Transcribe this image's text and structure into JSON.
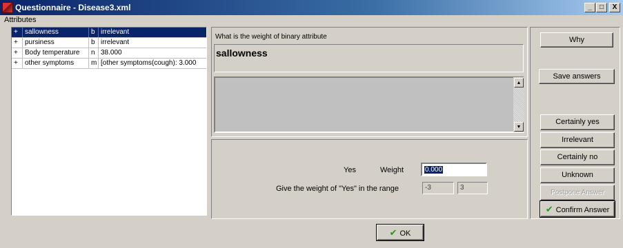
{
  "window": {
    "title": "Questionnaire - Disease3.xml",
    "minimize_glyph": "_",
    "maximize_glyph": "□",
    "close_glyph": "X"
  },
  "menu": {
    "attributes": "Attributes"
  },
  "attributes": [
    {
      "expand": "+",
      "name": "sallowness",
      "type": "b",
      "value": "irrelevant",
      "selected": true
    },
    {
      "expand": "+",
      "name": "pursiness",
      "type": "b",
      "value": "irrelevant",
      "selected": false
    },
    {
      "expand": "+",
      "name": "Body temperature",
      "type": "n",
      "value": "38.000",
      "selected": false
    },
    {
      "expand": "+",
      "name": "other symptoms",
      "type": "m",
      "value": "[other symptoms(cough): 3.000",
      "selected": false
    }
  ],
  "question": {
    "prompt": "What is the weight of binary attribute",
    "attribute": "sallowness",
    "description": ""
  },
  "answer": {
    "yes_label": "Yes",
    "weight_label": "Weight",
    "weight_value": "0.000",
    "range_label": "Give the weight of \"Yes\" in the range",
    "range_min": "-3",
    "range_max": "3"
  },
  "buttons": {
    "why": "Why",
    "save_answers": "Save answers",
    "certainly_yes": "Certainly yes",
    "irrelevant": "Irrelevant",
    "certainly_no": "Certainly no",
    "unknown": "Unknown",
    "postpone": "Postpone Answer",
    "confirm": "Confirm Answer",
    "ok": "OK"
  },
  "icons": {
    "check_glyph": "✔",
    "scroll_up_glyph": "▲",
    "scroll_down_glyph": "▼",
    "check_color": "#1a9a1a"
  }
}
